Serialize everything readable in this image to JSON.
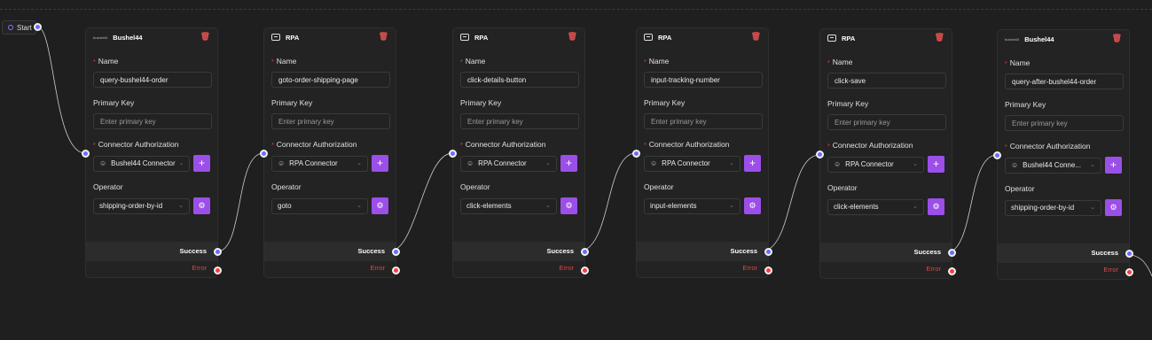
{
  "start": {
    "label": "Start"
  },
  "common": {
    "name_label": "Name",
    "pk_label": "Primary Key",
    "pk_placeholder": "Enter primary key",
    "auth_label": "Connector Authorization",
    "op_label": "Operator",
    "success_label": "Success",
    "error_label": "Error",
    "add_symbol": "+",
    "gear_symbol": "⚙",
    "trash_symbol": "🗑",
    "chevron": "⌄",
    "user_icon": "☺",
    "required_mark": "*"
  },
  "colors": {
    "background": "#1f1f1f",
    "accent_purple": "#9b4fe8",
    "handle_blue": "#6a6cff",
    "error_red": "#ff3b3b"
  },
  "nodes": [
    {
      "type": "Bushel44",
      "brand": "bushel44",
      "icon": "bushel44-logo",
      "name": "query-bushel44-order",
      "connector": "Bushel44 Connector",
      "operator": "shipping-order-by-id"
    },
    {
      "type": "RPA",
      "brand": "",
      "icon": "rpa-icon",
      "name": "goto-order-shipping-page",
      "connector": "RPA Connector",
      "operator": "goto"
    },
    {
      "type": "RPA",
      "brand": "",
      "icon": "rpa-icon",
      "name": "click-details-button",
      "connector": "RPA Connector",
      "operator": "click-elements"
    },
    {
      "type": "RPA",
      "brand": "",
      "icon": "rpa-icon",
      "name": "input-tracking-number",
      "connector": "RPA Connector",
      "operator": "input-elements"
    },
    {
      "type": "RPA",
      "brand": "",
      "icon": "rpa-icon",
      "name": "click-save",
      "connector": "RPA Connector",
      "operator": "click-elements"
    },
    {
      "type": "Bushel44",
      "brand": "bushel44",
      "icon": "bushel44-logo",
      "name": "query-after-bushel44-order",
      "connector": "Bushel44 Conne...",
      "operator": "shipping-order-by-id"
    }
  ]
}
